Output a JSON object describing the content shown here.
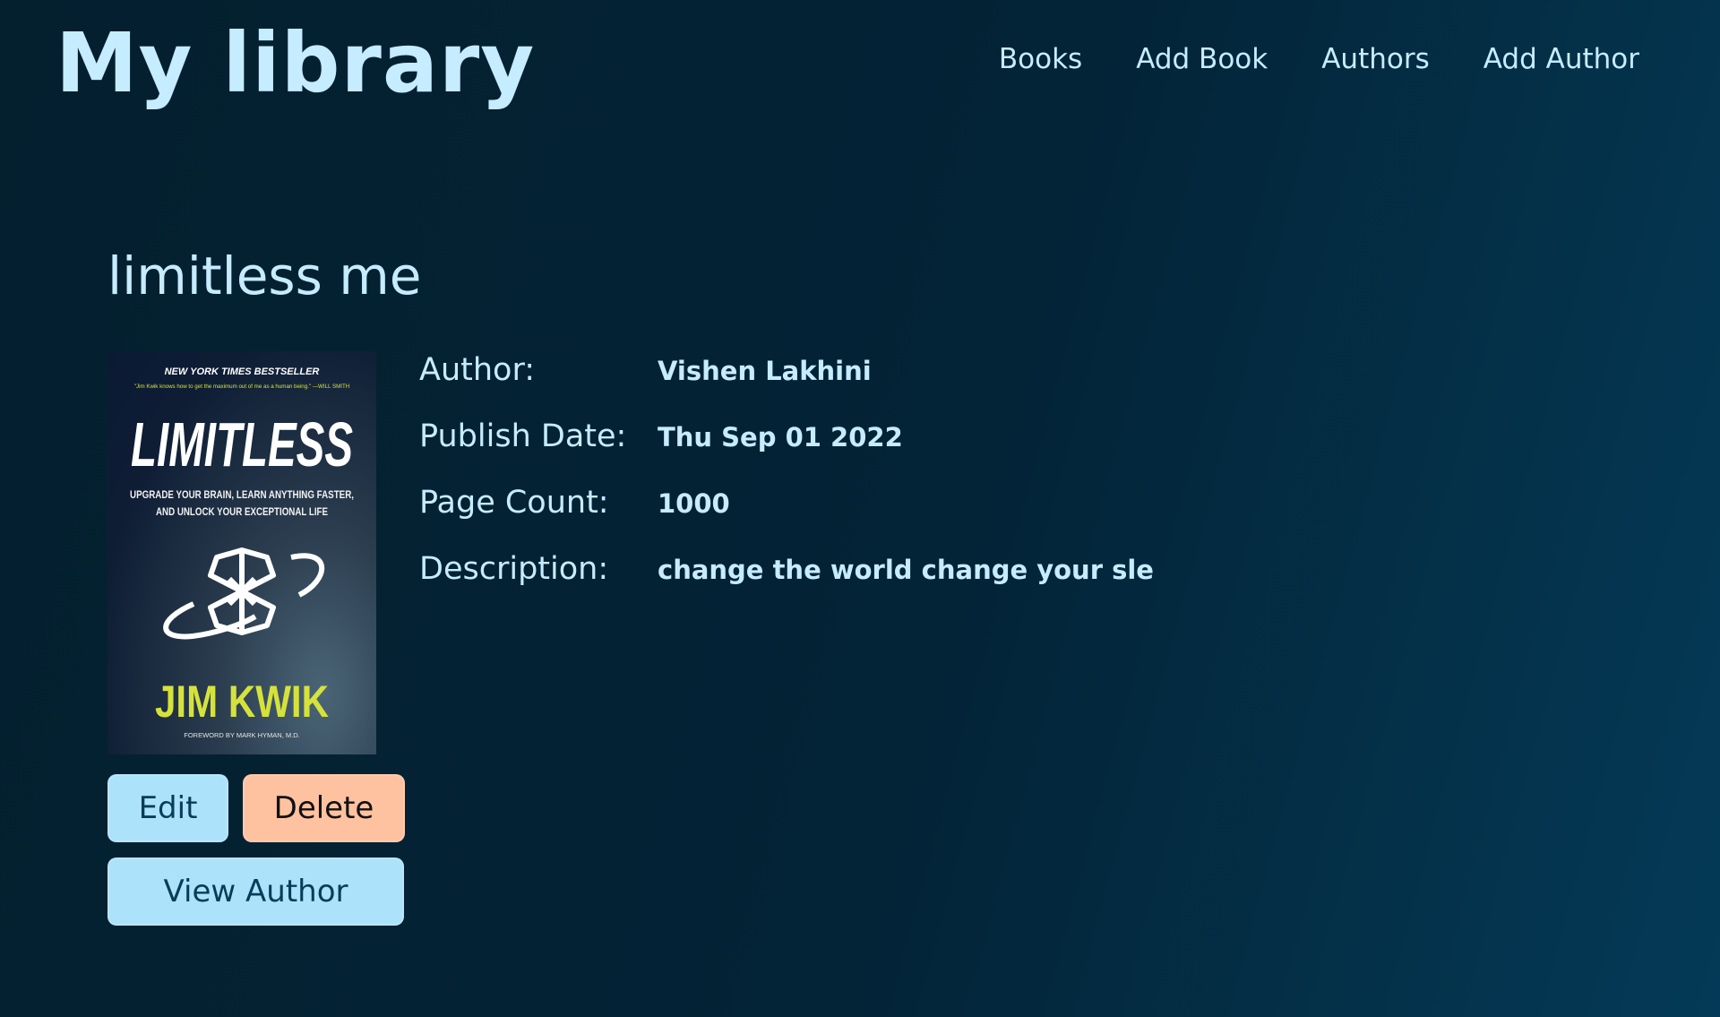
{
  "header": {
    "site_title": "My library",
    "nav": [
      {
        "label": "Books"
      },
      {
        "label": "Add Book"
      },
      {
        "label": "Authors"
      },
      {
        "label": "Add Author"
      }
    ]
  },
  "book": {
    "title": "limitless me",
    "cover": {
      "top_line": "NEW YORK TIMES BESTSELLER",
      "quote": "\"Jim Kwik knows how to get the maximum out of me as a human being.\" —WILL SMITH",
      "title": "LIMITLESS",
      "subtitle_line1": "UPGRADE YOUR BRAIN, LEARN ANYTHING FASTER,",
      "subtitle_line2": "AND UNLOCK YOUR EXCEPTIONAL LIFE",
      "author": "JIM KWIK",
      "foreword": "FOREWORD BY MARK HYMAN, M.D."
    },
    "details": [
      {
        "label": "Author:",
        "value": "Vishen Lakhini"
      },
      {
        "label": "Publish Date:",
        "value": "Thu Sep 01 2022"
      },
      {
        "label": "Page Count:",
        "value": "1000"
      },
      {
        "label": "Description:",
        "value": "change the world change your sle"
      }
    ]
  },
  "actions": {
    "edit_label": "Edit",
    "delete_label": "Delete",
    "view_author_label": "View Author"
  },
  "colors": {
    "text": "#c6ecff",
    "primary_button": "#ade2fb",
    "danger_button": "#fec2a1",
    "cover_author": "#d6e23c"
  }
}
